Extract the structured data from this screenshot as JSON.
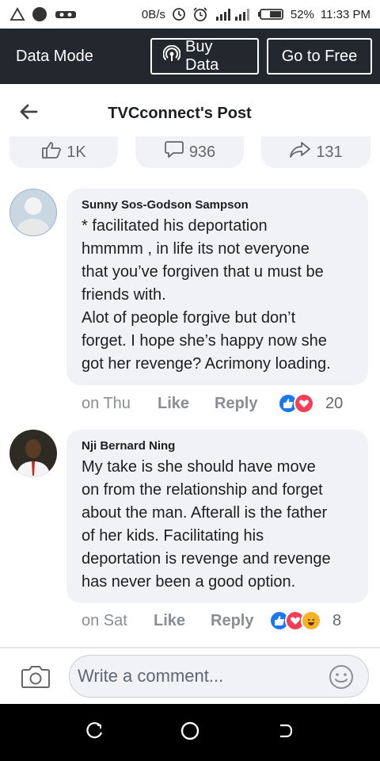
{
  "status_bar": {
    "network_speed": "0B/s",
    "battery": "52%",
    "time": "11:33 PM"
  },
  "data_bar": {
    "label": "Data Mode",
    "buy_data_label": "Buy Data",
    "go_free_label": "Go to Free"
  },
  "header": {
    "title": "TVCconnect's Post"
  },
  "post_stats": {
    "likes": "1K",
    "comments": "936",
    "shares": "131"
  },
  "comments": [
    {
      "author": "Sunny Sos-Godson Sampson",
      "text": "* facilitated his deportation\nhmmmm , in life its not everyone\nthat you’ve forgiven that u must be\nfriends with.\nAlot of people forgive but don’t\nforget. I hope she’s happy now she\ngot her revenge? Acrimony loading.",
      "time": "on Thu",
      "like_label": "Like",
      "reply_label": "Reply",
      "reaction_count": "20"
    },
    {
      "author": "Nji Bernard Ning",
      "text": "My take is she should have move\non from the relationship and forget\nabout the man. Afterall is the father\nof her kids. Facilitating his\ndeportation is revenge and revenge\nhas never been a good option.",
      "time": "on Sat",
      "like_label": "Like",
      "reply_label": "Reply",
      "reaction_count": "8"
    }
  ],
  "composer": {
    "placeholder": "Write a comment..."
  },
  "colors": {
    "data_bar_bg": "#23272e",
    "bubble_bg": "#f0f2f5",
    "like_blue": "#1877f2",
    "love_red": "#f33e58",
    "haha_yellow": "#f7b125"
  }
}
